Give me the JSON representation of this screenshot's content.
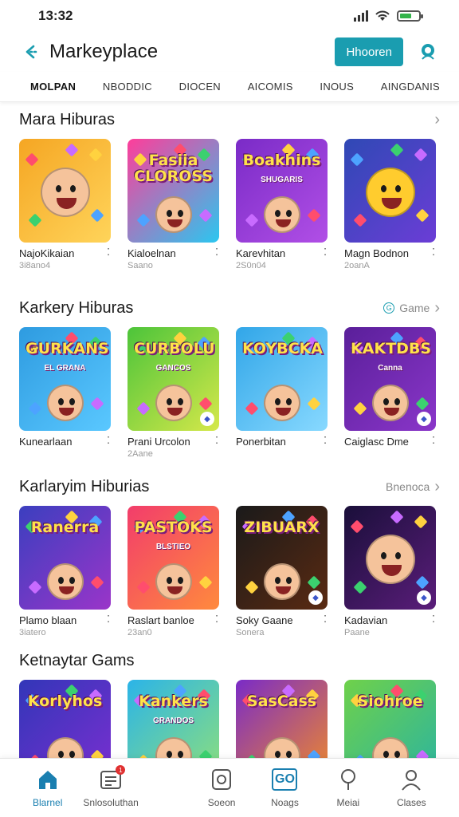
{
  "status_bar": {
    "time": "13:32"
  },
  "header": {
    "title": "Markeyplace",
    "action_label": "Hhooren"
  },
  "tabs": [
    {
      "label": "MOLPAN",
      "active": true
    },
    {
      "label": "NBODDIC",
      "active": false
    },
    {
      "label": "DIOCEN",
      "active": false
    },
    {
      "label": "AICOMIS",
      "active": false
    },
    {
      "label": "INOUS",
      "active": false
    },
    {
      "label": "AINGDANIS",
      "active": false
    }
  ],
  "sections": [
    {
      "title": "Mara Hiburas",
      "more_label": "",
      "cards": [
        {
          "name": "NajoKikaian",
          "sub": "3i8ano4",
          "thumb_text": "",
          "thumb_sub": "",
          "bg": "#f5a623",
          "bg2": "#ffd45a"
        },
        {
          "name": "Kialoelnan",
          "sub": "Saano",
          "thumb_text": "Fasiia CLOROSS",
          "thumb_sub": "",
          "bg": "#ff3d9a",
          "bg2": "#2ac7f0"
        },
        {
          "name": "Karevhitan",
          "sub": "2S0n04",
          "thumb_text": "Boakhins",
          "thumb_sub": "SHUGARIS",
          "bg": "#7a2bc7",
          "bg2": "#b14fe6"
        },
        {
          "name": "Magn Bodnon",
          "sub": "2oanA",
          "thumb_text": "",
          "thumb_sub": "",
          "bg": "#2f49b5",
          "bg2": "#6b3dd6"
        }
      ]
    },
    {
      "title": "Karkery Hiburas",
      "more_label": "Game",
      "cards": [
        {
          "name": "Kunearlaan",
          "sub": "",
          "thumb_text": "GURKANS",
          "thumb_sub": "EL GRANA",
          "bg": "#2e9be0",
          "bg2": "#5ac8ff"
        },
        {
          "name": "Prani Urcolon",
          "sub": "2Aane",
          "thumb_text": "CURBOLU",
          "thumb_sub": "GANCOS",
          "bg": "#4cc43a",
          "bg2": "#d5e84a"
        },
        {
          "name": "Ponerbitan",
          "sub": "",
          "thumb_text": "KOYBCKA",
          "thumb_sub": "",
          "bg": "#31a6e8",
          "bg2": "#88d9ff"
        },
        {
          "name": "Caiglasc Dme",
          "sub": "",
          "thumb_text": "KAKTDBS",
          "thumb_sub": "Canna",
          "bg": "#5a1f9a",
          "bg2": "#8a36c9"
        }
      ]
    },
    {
      "title": "Karlaryim Hiburias",
      "more_label": "Bnenoca",
      "cards": [
        {
          "name": "Plamo blaan",
          "sub": "3iatero",
          "thumb_text": "Ranerra",
          "thumb_sub": "",
          "bg": "#3b3fbf",
          "bg2": "#9a35c9"
        },
        {
          "name": "Raslart banloe",
          "sub": "23an0",
          "thumb_text": "PASTOKS",
          "thumb_sub": "BLSTIEO",
          "bg": "#f23d6b",
          "bg2": "#ff8a3d"
        },
        {
          "name": "Soky Gaane",
          "sub": "Sonera",
          "thumb_text": "ZIBUARX",
          "thumb_sub": "",
          "bg": "#1a1a1a",
          "bg2": "#5a2a12"
        },
        {
          "name": "Kadavian",
          "sub": "Paane",
          "thumb_text": "",
          "thumb_sub": "",
          "bg": "#1a0f3a",
          "bg2": "#5a1d7a"
        }
      ]
    },
    {
      "title": "Ketnaytar Gams",
      "more_label": "",
      "cards": [
        {
          "name": "",
          "sub": "",
          "thumb_text": "Korlyhos",
          "thumb_sub": "",
          "bg": "#3236b8",
          "bg2": "#7b2fd1"
        },
        {
          "name": "",
          "sub": "",
          "thumb_text": "Kankers",
          "thumb_sub": "GRANDOS",
          "bg": "#2bb4e8",
          "bg2": "#8fe07a"
        },
        {
          "name": "",
          "sub": "",
          "thumb_text": "SasCass",
          "thumb_sub": "",
          "bg": "#7a2bc7",
          "bg2": "#f08a2a"
        },
        {
          "name": "",
          "sub": "",
          "thumb_text": "Siohroe",
          "thumb_sub": "",
          "bg": "#6fd14a",
          "bg2": "#2bb4a0"
        }
      ]
    }
  ],
  "bottom_nav": [
    {
      "label": "Blarnel",
      "icon": "home-icon",
      "active": true
    },
    {
      "label": "Snlosoluthan",
      "icon": "news-icon",
      "active": false,
      "badge": "1"
    },
    {
      "label": "Soeon",
      "icon": "game-card-icon",
      "active": false
    },
    {
      "label": "Noags",
      "icon": "gg-icon",
      "active": false,
      "glyph": "GO"
    },
    {
      "label": "Meiai",
      "icon": "location-pin-icon",
      "active": false
    },
    {
      "label": "Clases",
      "icon": "profile-icon",
      "active": false
    }
  ]
}
